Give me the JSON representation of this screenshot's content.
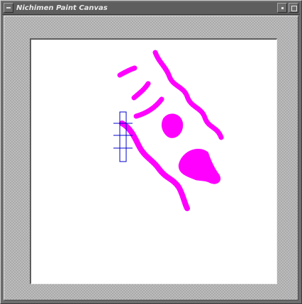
{
  "window": {
    "title": "Nichimen Paint Canvas"
  },
  "canvas": {
    "background_color": "#ffffff",
    "brush_color": "#ff00ff",
    "cursor_color": "#0000cc"
  },
  "icons": {
    "window_menu": "window-menu-icon",
    "minimize": "minimize-icon",
    "maximize": "maximize-icon",
    "cursor": "brush-cursor-icon"
  }
}
